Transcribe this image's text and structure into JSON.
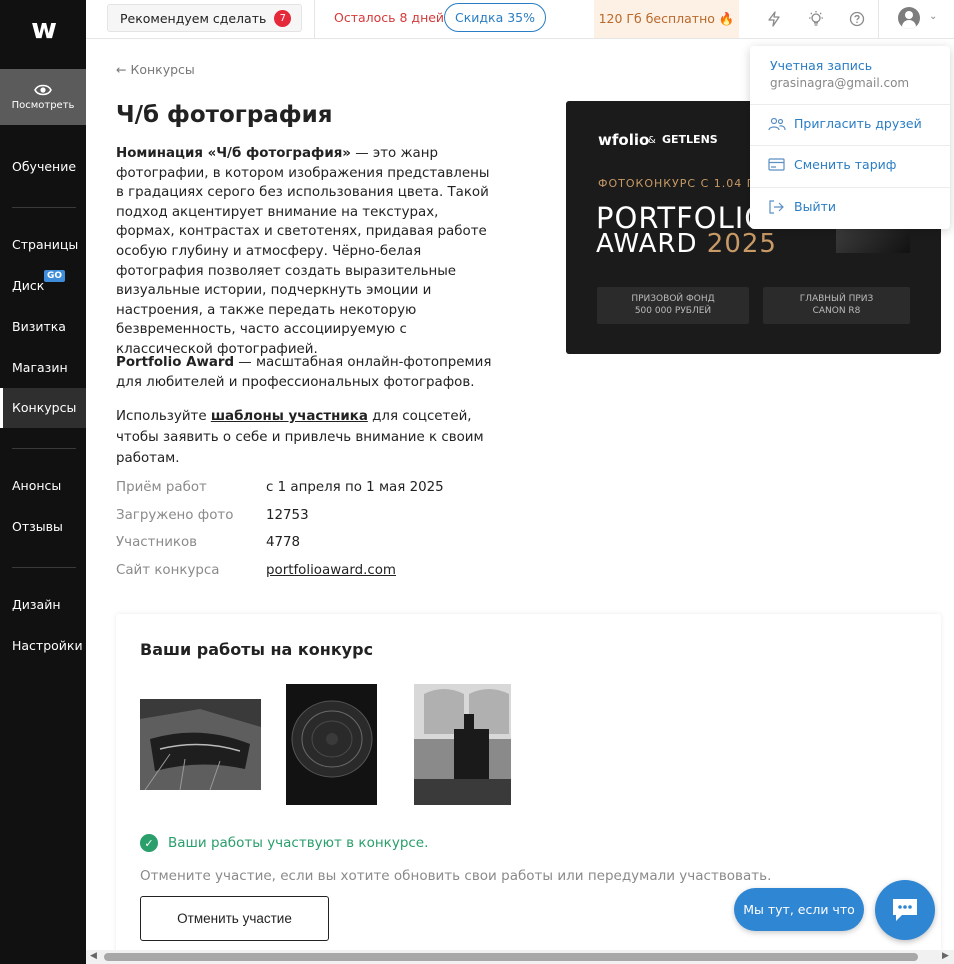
{
  "sidebar": {
    "logo": "w",
    "view_label": "Посмотреть",
    "items": [
      {
        "label": "Обучение"
      },
      {
        "label": "Страницы"
      },
      {
        "label": "Диск",
        "badge": "GO"
      },
      {
        "label": "Визитка"
      },
      {
        "label": "Магазин"
      },
      {
        "label": "Конкурсы"
      },
      {
        "label": "Анонсы"
      },
      {
        "label": "Отзывы"
      },
      {
        "label": "Дизайн"
      },
      {
        "label": "Настройки"
      }
    ]
  },
  "topbar": {
    "recommend_label": "Рекомендуем сделать",
    "recommend_count": "7",
    "days_left": "Осталось 8 дней",
    "discount": "Скидка 35%",
    "free_gb": "120 Гб бесплатно 🔥"
  },
  "account_menu": {
    "title": "Учетная запись",
    "email": "grasinagra@gmail.com",
    "invite": "Пригласить друзей",
    "change_plan": "Сменить тариф",
    "logout": "Выйти"
  },
  "page": {
    "back_label": "Конкурсы",
    "title": "Ч/б фотография",
    "desc_bold": "Номинация «Ч/б фотография»",
    "desc_rest": " — это жанр фотографии, в котором изображения представлены в градациях серого без использования цвета. Такой подход акцентирует внимание на текстурах, формах, контрастах и светотенях, придавая работе особую глубину и атмосферу. Чёрно-белая фотография позволяет создать выразительные визуальные истории, подчеркнуть эмоции и настроения, а также передать некоторую безвременность, часто ассоциируемую с классической фотографией.",
    "award_bold": "Portfolio Award",
    "award_rest": " — масштабная онлайн-фотопремия для любителей и профессиональных фотографов.",
    "templates_pre": "Используйте ",
    "templates_link": "шаблоны участника",
    "templates_post": " для соцсетей, чтобы заявить о себе и привлечь внимание к своим работам."
  },
  "info": [
    {
      "key": "Приём работ",
      "value": "с 1 апреля по 1 мая 2025"
    },
    {
      "key": "Загружено фото",
      "value": "12753"
    },
    {
      "key": "Участников",
      "value": "4778"
    },
    {
      "key": "Сайт конкурса",
      "value": "portfolioaward.com"
    }
  ],
  "banner": {
    "brand": "wfolio",
    "amp": "&",
    "partner": "GETLENS",
    "contest_line": "ФОТОКОНКУРС С 1.04 П",
    "big1": "PORTFOLIO",
    "big2": "AWARD",
    "year": "2025",
    "prize_fund_label": "ПРИЗОВОЙ ФОНД",
    "prize_fund_value": "500 000 РУБЛЕЙ",
    "main_prize_label": "ГЛАВНЫЙ ПРИЗ",
    "main_prize_value": "CANON R8"
  },
  "works": {
    "title": "Ваши работы на конкурс",
    "status": "Ваши работы участвуют в конкурсе.",
    "hint": "Отмените участие, если вы хотите обновить свои работы или передумали участвовать.",
    "cancel": "Отменить участие"
  },
  "chat": {
    "pill": "Мы тут, если что"
  },
  "colors": {
    "accent": "#2a7dc4",
    "success": "#2a9e6b",
    "danger": "#e5283a",
    "sidebar_bg": "#111111"
  }
}
